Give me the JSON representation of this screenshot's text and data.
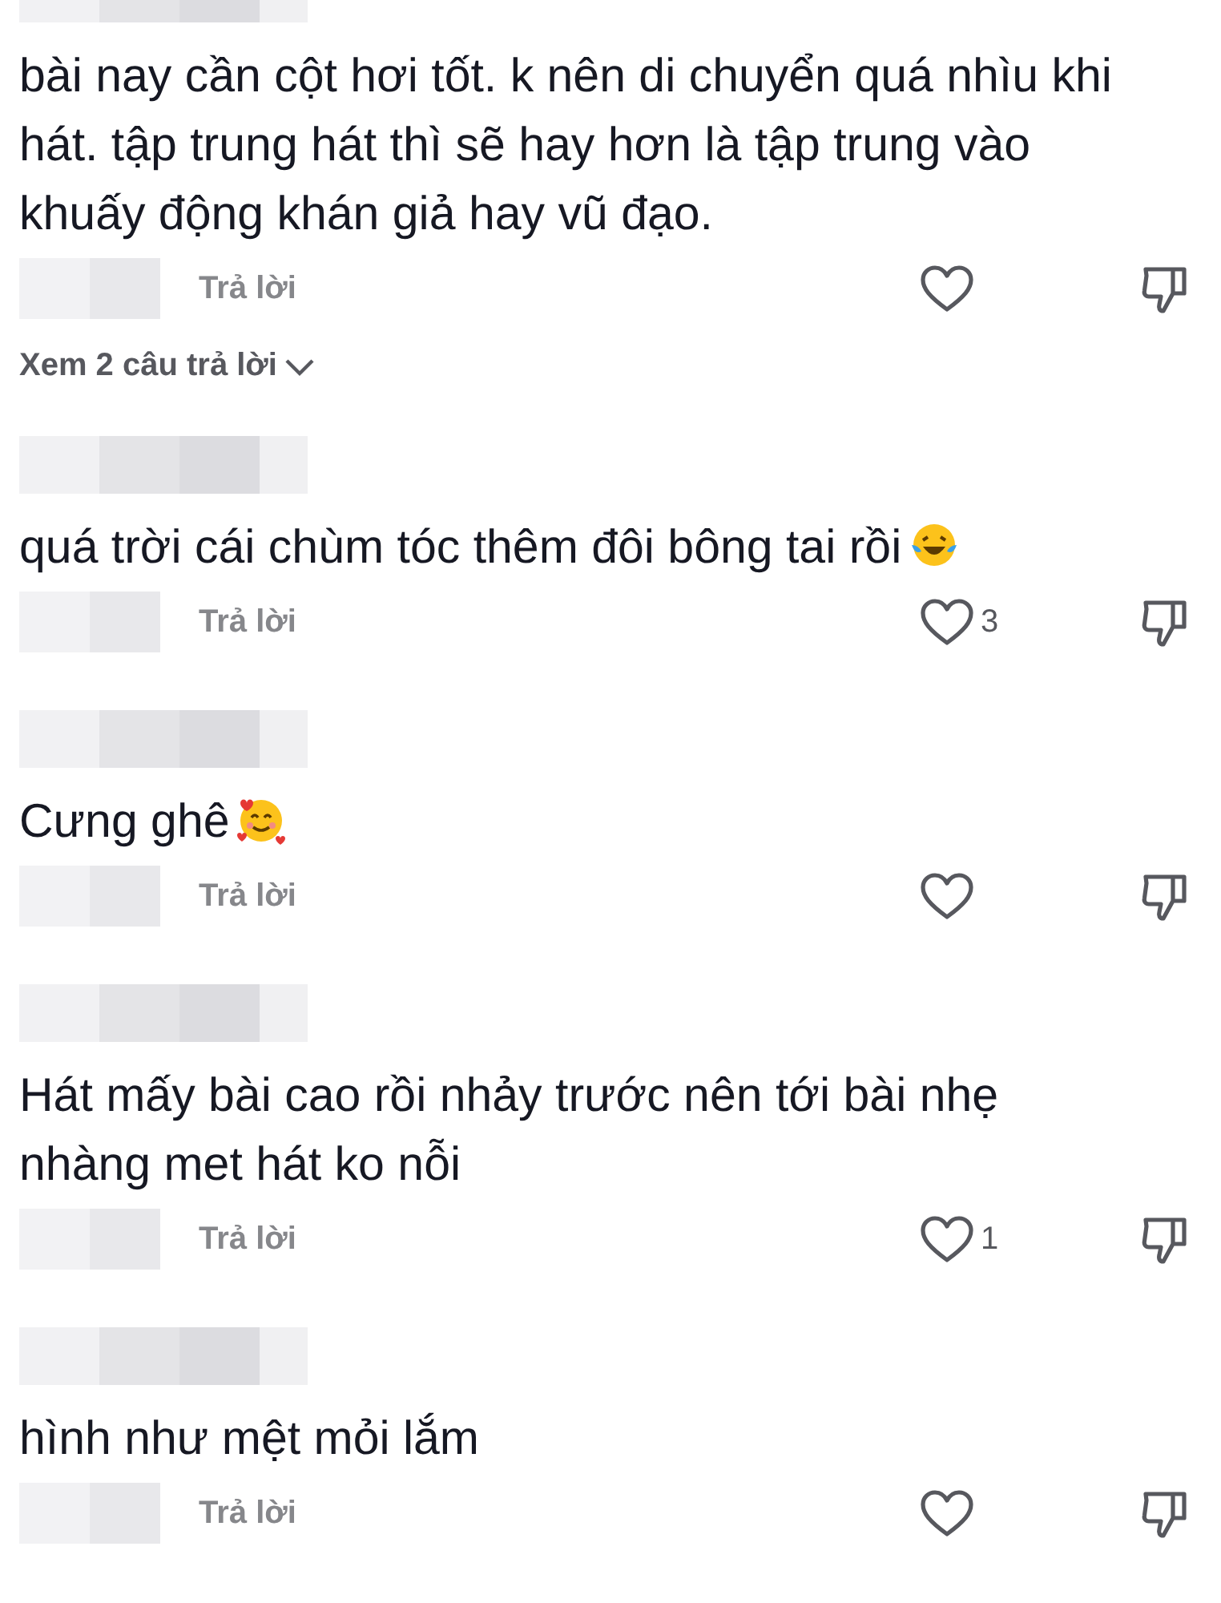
{
  "comments": [
    {
      "text": "bài nay cần cột hơi tốt. k nên di chuyển quá nhìu khi hát. tập trung hát thì sẽ hay hơn là tập trung vào khuấy động khán giả hay vũ đạo.",
      "reply_label": "Trả lời",
      "view_replies": "Xem 2 câu trả lời"
    },
    {
      "text": "quá trời cái chùm tóc thêm đôi bông tai rồi",
      "emoji": {
        "kind": "laugh"
      },
      "reply_label": "Trả lời",
      "like_count": "3"
    },
    {
      "text": "Cưng ghê",
      "emoji": {
        "kind": "hearts"
      },
      "reply_label": "Trả lời"
    },
    {
      "text": "Hát mấy bài cao rồi nhảy trước nên tới bài nhẹ nhàng met hát ko nỗi",
      "reply_label": "Trả lời",
      "like_count": "1"
    },
    {
      "text": "hình như mệt mỏi lắm",
      "reply_label": "Trả lời"
    }
  ]
}
